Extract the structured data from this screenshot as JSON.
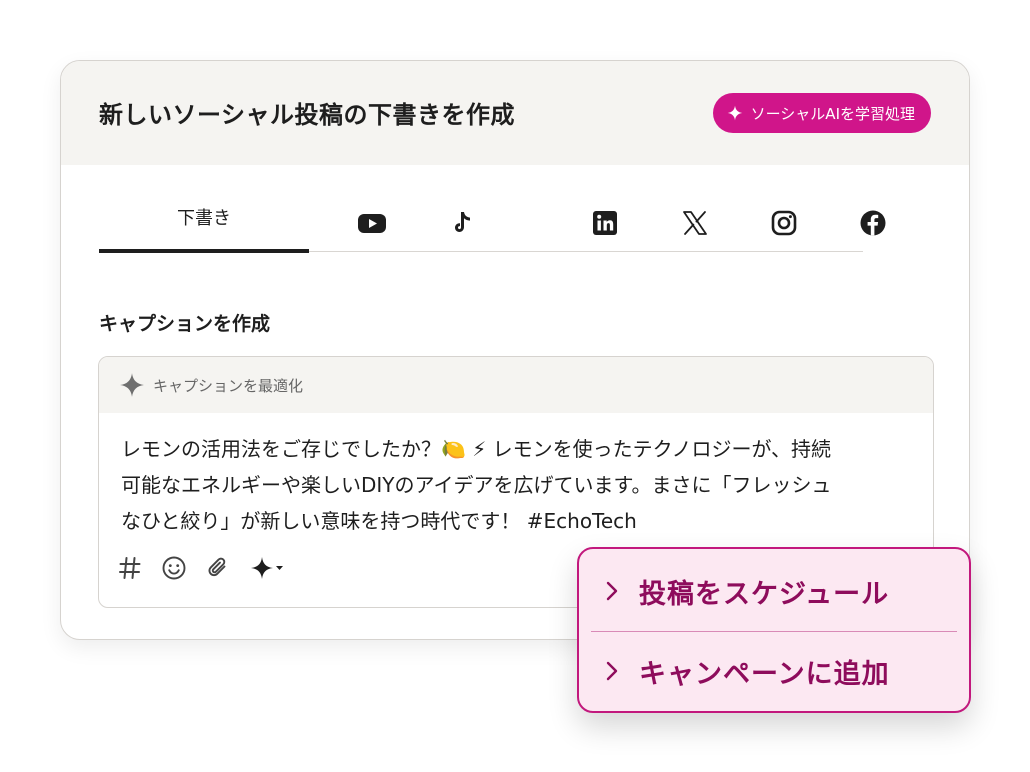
{
  "header": {
    "title": "新しいソーシャル投稿の下書きを作成",
    "ai_button_label": "ソーシャルAIを学習処理"
  },
  "tabs": [
    {
      "label": "下書き",
      "selected": true
    },
    {
      "icon": "youtube-icon"
    },
    {
      "icon": "tiktok-icon"
    },
    {
      "icon": "linkedin-icon"
    },
    {
      "icon": "x-icon"
    },
    {
      "icon": "instagram-icon"
    },
    {
      "icon": "facebook-icon"
    }
  ],
  "caption_section": {
    "label": "キャプションを作成",
    "optimize_label": "キャプションを最適化",
    "lines": [
      "レモンの活用法をご存じでしたか？🍋 ⚡ レモンを使ったテクノロジーが、持続",
      "可能なエネルギーや楽しいDIYのアイデアを広げています。まさに「フレッシュ",
      "なひと絞り」が新しい意味を持つ時代です！ #EchoTech"
    ]
  },
  "toolbar": {
    "icons": [
      "hashtag-icon",
      "emoji-icon",
      "attachment-icon",
      "ai-sparkle-dropdown-icon"
    ]
  },
  "popup_menu": {
    "items": [
      {
        "label": "投稿をスケジュール"
      },
      {
        "label": "キャンペーンに追加"
      }
    ]
  },
  "colors": {
    "accent": "#d0158a",
    "accent_dark": "#8e0c5c",
    "popup_bg": "#fce8f2",
    "header_bg": "#f5f4f1"
  }
}
